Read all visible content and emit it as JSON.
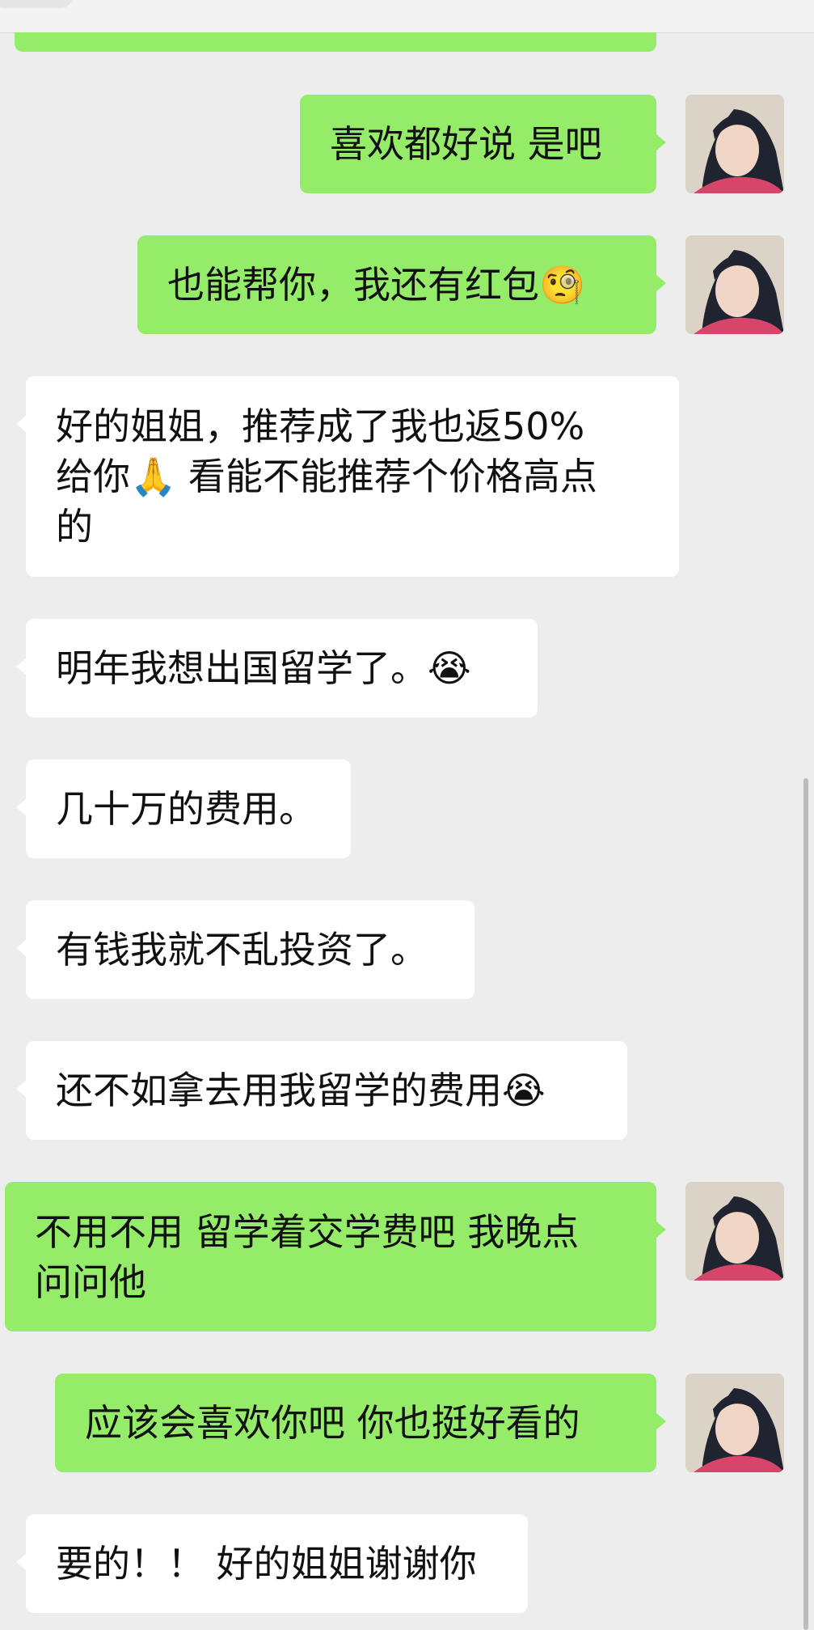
{
  "chat": {
    "messages": [
      {
        "from": "me",
        "lines": [
          "喜欢都好说 是吧"
        ],
        "avatar_icon": "user-avatar-photo"
      },
      {
        "from": "me",
        "lines": [
          "也能帮你，我还有红包🧐"
        ],
        "avatar_icon": "user-avatar-photo"
      },
      {
        "from": "other",
        "lines": [
          "好的姐姐，推荐成了我也返50%",
          "给你🙏 看能不能推荐个价格高点",
          "的"
        ]
      },
      {
        "from": "other",
        "lines": [
          "明年我想出国留学了。😭"
        ]
      },
      {
        "from": "other",
        "lines": [
          "几十万的费用。"
        ]
      },
      {
        "from": "other",
        "lines": [
          "有钱我就不乱投资了。"
        ]
      },
      {
        "from": "other",
        "lines": [
          "还不如拿去用我留学的费用😭"
        ]
      },
      {
        "from": "me",
        "lines": [
          "不用不用 留学着交学费吧 我晚点",
          "问问他"
        ],
        "avatar_icon": "user-avatar-photo"
      },
      {
        "from": "me",
        "lines": [
          "应该会喜欢你吧 你也挺好看的"
        ],
        "avatar_icon": "user-avatar-photo"
      },
      {
        "from": "other",
        "lines": [
          "要的！！ 好的姐姐谢谢你"
        ]
      }
    ]
  },
  "colors": {
    "background": "#ededed",
    "sent_bubble": "#95ec69",
    "received_bubble": "#ffffff",
    "text": "#111111"
  }
}
